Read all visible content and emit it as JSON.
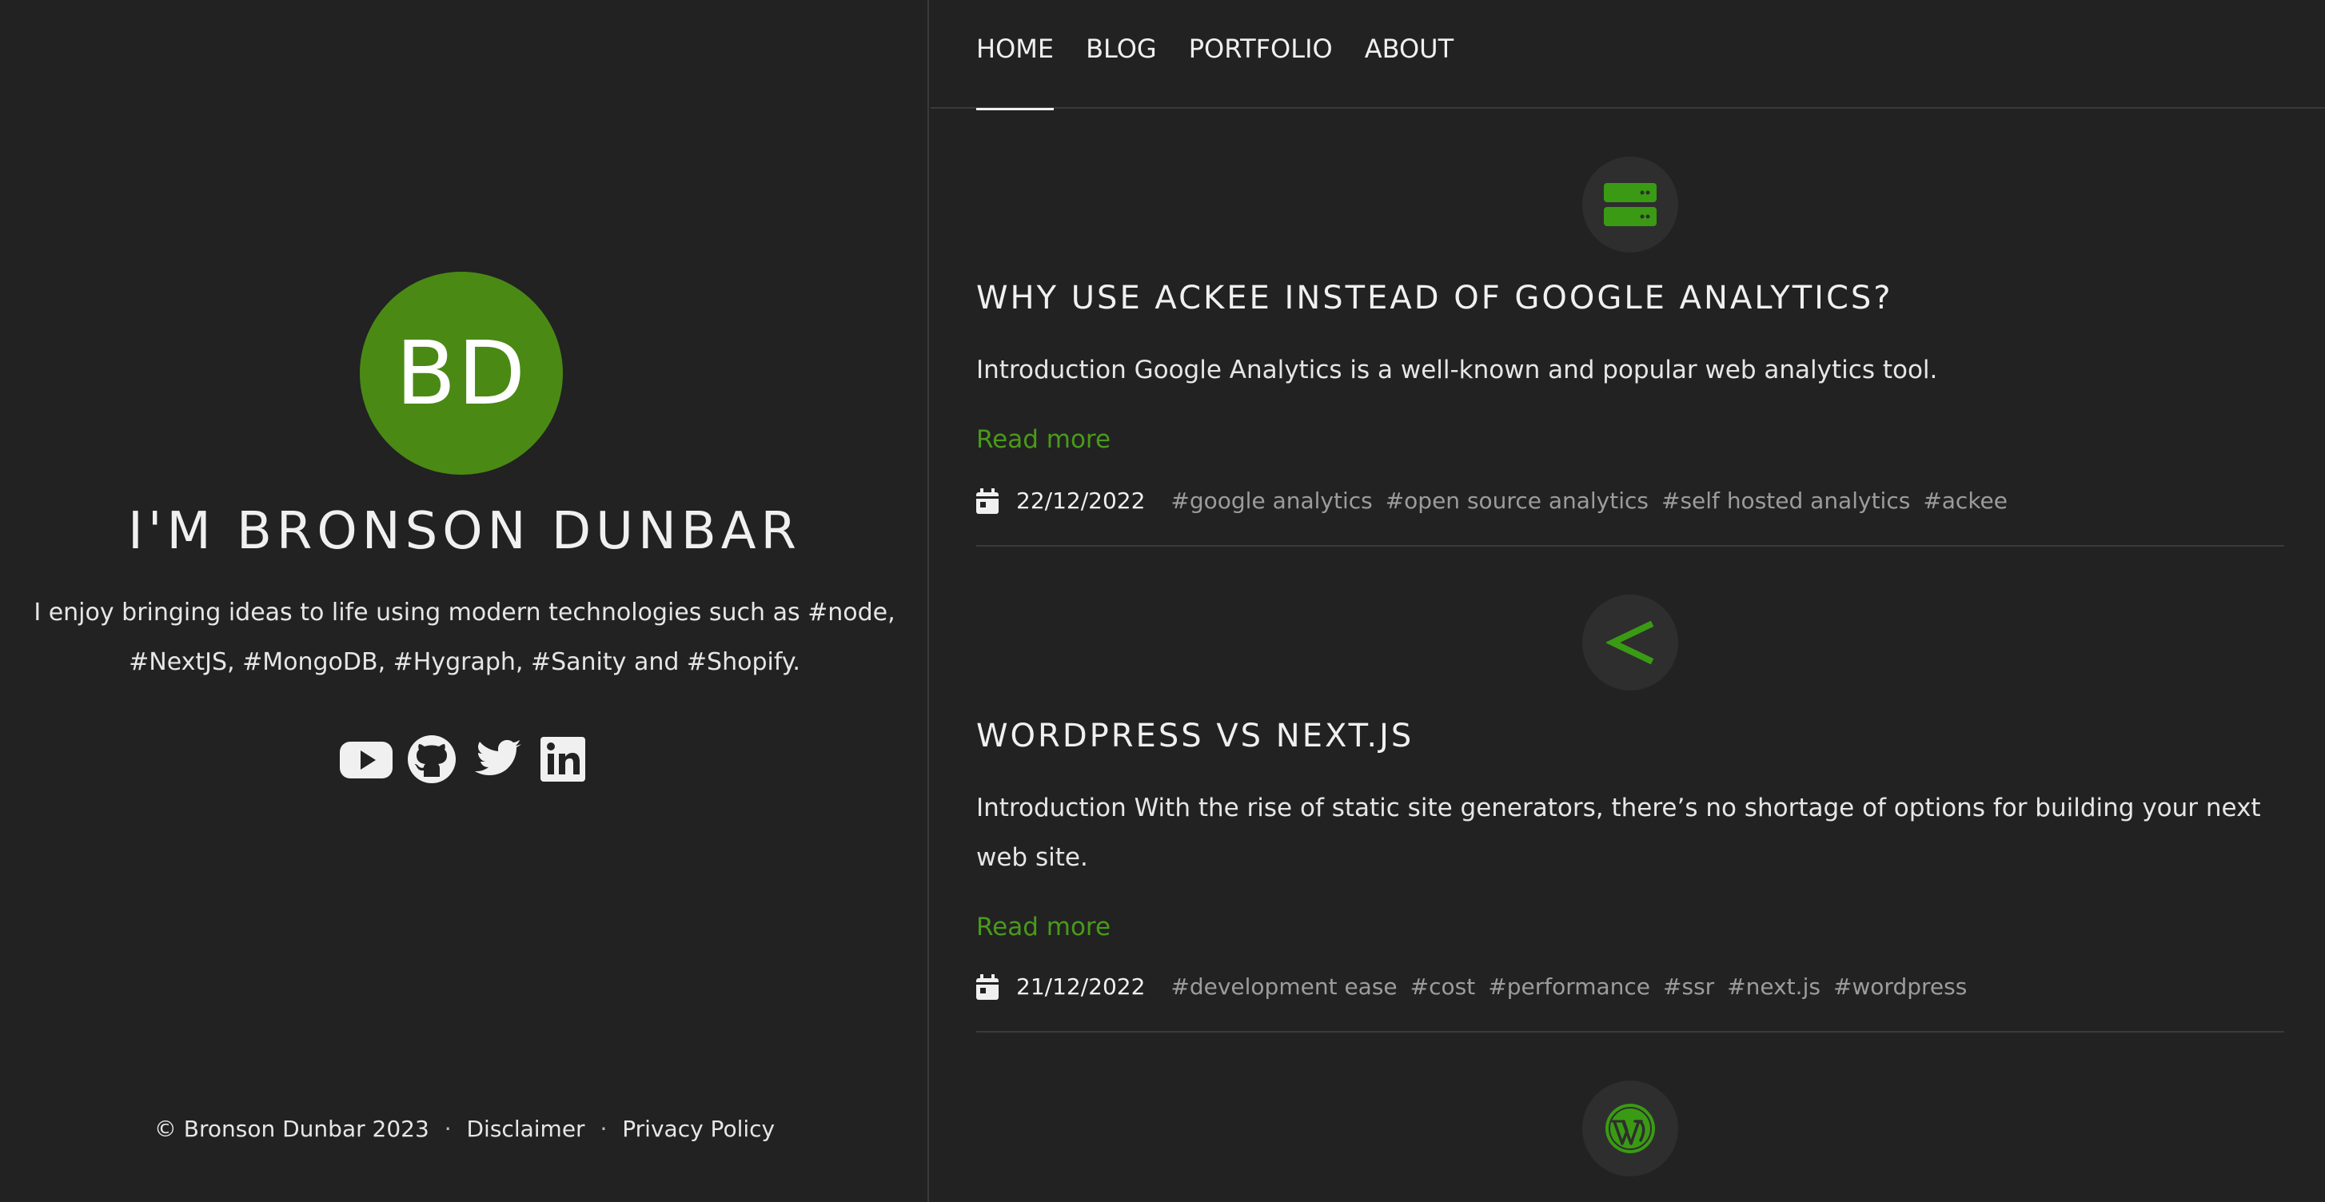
{
  "profile": {
    "initials": "BD",
    "name": "I'M BRONSON DUNBAR",
    "bio": "I enjoy bringing ideas to life using modern technologies such as #node, #NextJS, #MongoDB, #Hygraph, #Sanity and #Shopify.",
    "accent_color": "#4a8a14",
    "social": [
      {
        "name": "youtube",
        "icon": "youtube-icon"
      },
      {
        "name": "github",
        "icon": "github-icon"
      },
      {
        "name": "twitter",
        "icon": "twitter-icon"
      },
      {
        "name": "linkedin",
        "icon": "linkedin-icon"
      }
    ]
  },
  "footer": {
    "copyright": "© Bronson Dunbar 2023",
    "separator": "·",
    "disclaimer": "Disclaimer",
    "privacy": "Privacy Policy"
  },
  "nav": {
    "items": [
      "HOME",
      "BLOG",
      "PORTFOLIO",
      "ABOUT"
    ],
    "active": "HOME"
  },
  "posts": [
    {
      "icon": "server-icon",
      "title": "WHY USE ACKEE INSTEAD OF GOOGLE ANALYTICS?",
      "excerpt": "Introduction Google Analytics is a well-known and popular web analytics tool.",
      "read_more": "Read more",
      "date": "22/12/2022",
      "tags": [
        "#google analytics",
        "#open source analytics",
        "#self hosted analytics",
        "#ackee"
      ]
    },
    {
      "icon": "less-than-icon",
      "title": "WORDPRESS VS NEXT.JS",
      "excerpt": "Introduction With the rise of static site generators, there’s no shortage of options for building your next web site.",
      "read_more": "Read more",
      "date": "21/12/2022",
      "tags": [
        "#development ease",
        "#cost",
        "#performance",
        "#ssr",
        "#next.js",
        "#wordpress"
      ]
    },
    {
      "icon": "wordpress-icon"
    }
  ],
  "colors": {
    "background": "#222222",
    "link_green": "#4a9a1a",
    "icon_green": "#3a9a14",
    "tag_gray": "#9c9c9c"
  }
}
